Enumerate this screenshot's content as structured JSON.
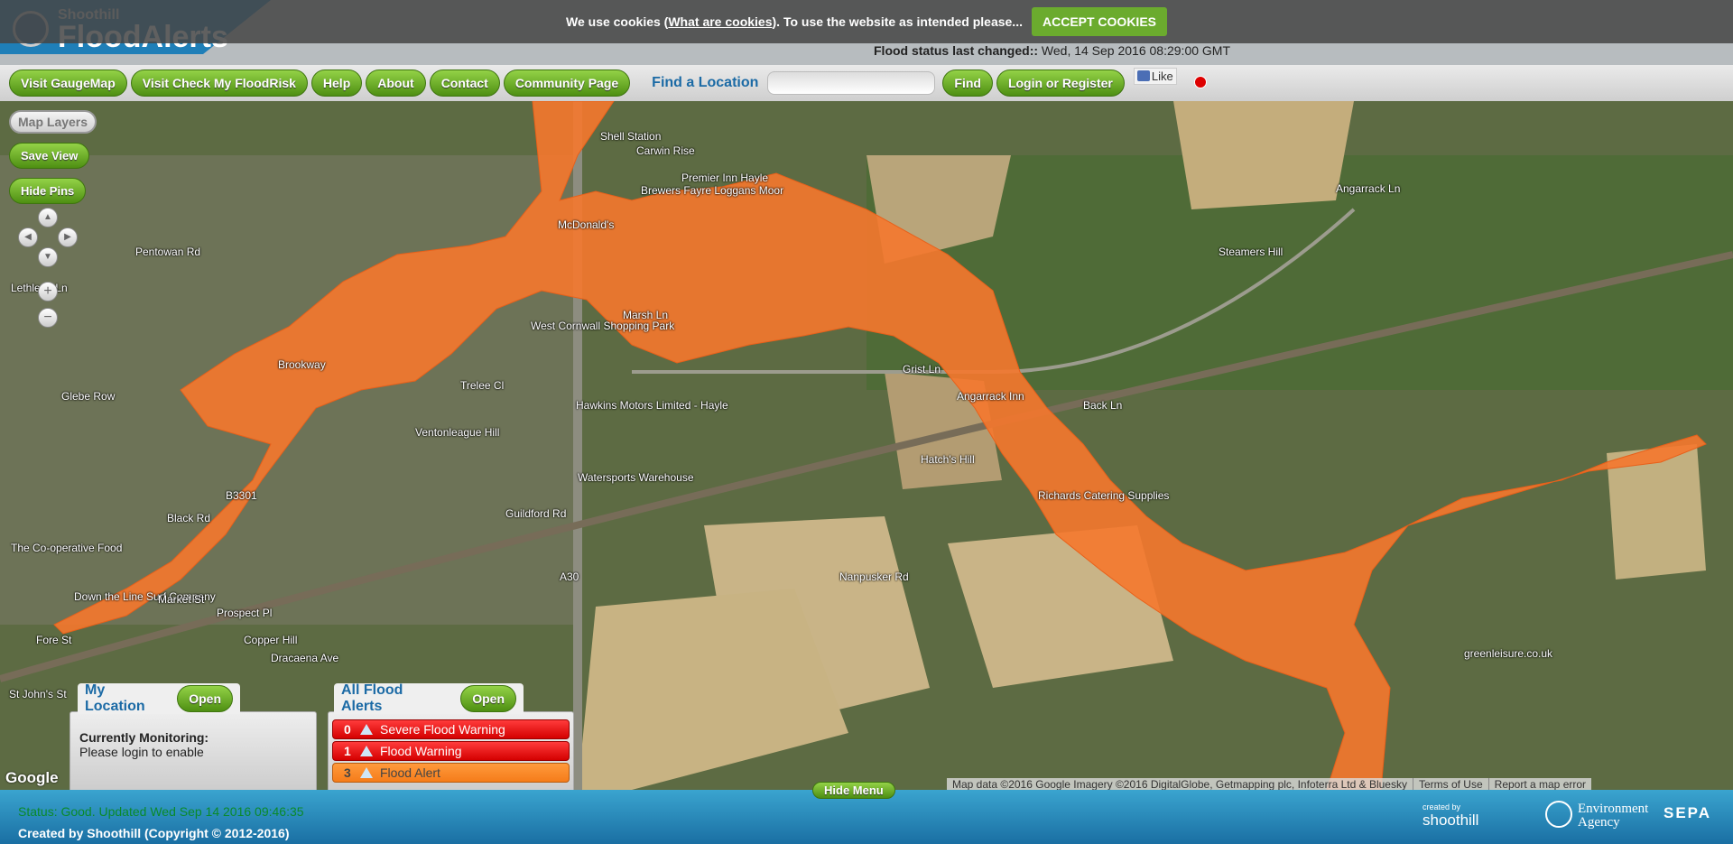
{
  "header": {
    "logo_small": "Shoothill",
    "logo_big": "FloodAlerts",
    "status_changed_label": "Flood status last changed::",
    "status_changed_value": "Wed, 14 Sep 2016 08:29:00 GMT"
  },
  "cookie_bar": {
    "text_prefix": "We use cookies (",
    "link": "What are cookies",
    "text_suffix": "). To use the website as intended please...",
    "accept_label": "ACCEPT COOKIES"
  },
  "nav": {
    "buttons": [
      "Visit GaugeMap",
      "Visit Check My FloodRisk",
      "Help",
      "About",
      "Contact",
      "Community Page"
    ],
    "find_label": "Find a Location",
    "find_input_value": "",
    "find_button": "Find",
    "login_button": "Login or Register",
    "fb_like": "Like"
  },
  "map_controls": {
    "map_layers": "Map Layers",
    "save_view": "Save View",
    "hide_pins": "Hide Pins",
    "pan_up": "▲",
    "pan_left": "◀",
    "pan_right": "▶",
    "pan_down": "▼",
    "zoom_in": "+",
    "zoom_out": "−"
  },
  "map": {
    "flood_color": "#f5782d",
    "labels": [
      {
        "text": "Shell Station"
      },
      {
        "text": "Carwin Rise"
      },
      {
        "text": "Premier Inn Hayle"
      },
      {
        "text": "Brewers Fayre Loggans Moor"
      },
      {
        "text": "McDonald's"
      },
      {
        "text": "West Cornwall Shopping Park"
      },
      {
        "text": "Marsh Ln"
      },
      {
        "text": "Hawkins Motors Limited - Hayle"
      },
      {
        "text": "Watersports Warehouse"
      },
      {
        "text": "Grist Ln"
      },
      {
        "text": "Angarrack Inn"
      },
      {
        "text": "Back Ln"
      },
      {
        "text": "Richards Catering Supplies"
      },
      {
        "text": "Hatch's Hill"
      },
      {
        "text": "Nanpusker Rd"
      },
      {
        "text": "The Co-operative Food"
      },
      {
        "text": "Down the Line Surf Company"
      },
      {
        "text": "greenleisure.co.uk"
      },
      {
        "text": "Steamers Hill"
      },
      {
        "text": "Angarrack Ln"
      },
      {
        "text": "Glebe Row"
      },
      {
        "text": "Pentowan Rd"
      },
      {
        "text": "Lethlean Ln"
      },
      {
        "text": "Ventonleague Hill"
      },
      {
        "text": "Guildford Rd"
      },
      {
        "text": "A30"
      },
      {
        "text": "B3301"
      },
      {
        "text": "Black Rd"
      },
      {
        "text": "Fore St"
      },
      {
        "text": "Market St"
      },
      {
        "text": "Prospect Pl"
      },
      {
        "text": "St John's St"
      },
      {
        "text": "Copper Hill"
      },
      {
        "text": "Dracaena Ave"
      },
      {
        "text": "Brookway"
      },
      {
        "text": "Trelee Cl"
      }
    ],
    "google_logo": "Google",
    "attribution": "Map data ©2016 Google Imagery ©2016 DigitalGlobe, Getmapping plc, Infoterra Ltd & Bluesky",
    "terms": "Terms of Use",
    "report": "Report a map error"
  },
  "my_location": {
    "title": "My Location",
    "open_button": "Open",
    "monitoring_label": "Currently Monitoring:",
    "monitoring_value": "Please login to enable"
  },
  "all_alerts": {
    "title": "All Flood Alerts",
    "open_button": "Open",
    "rows": [
      {
        "count": "0",
        "label": "Severe Flood Warning",
        "color": "#e80000"
      },
      {
        "count": "1",
        "label": "Flood Warning",
        "color": "#e80000"
      },
      {
        "count": "3",
        "label": "Flood Alert",
        "color": "#f5821f"
      }
    ]
  },
  "hide_menu": "Hide Menu",
  "footer": {
    "status": "Status: Good. Updated Wed Sep 14 2016 09:46:35",
    "copyright": "Created by Shoothill (Copyright © 2012-2016)",
    "logos": {
      "shoothill_small": "created by",
      "shoothill": "shoothill",
      "ea_line1": "Environment",
      "ea_line2": "Agency",
      "sepa": "SEPA"
    }
  }
}
